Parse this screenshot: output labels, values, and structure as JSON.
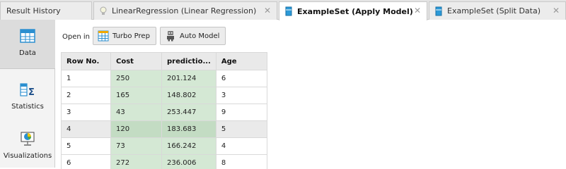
{
  "tabs": [
    {
      "label": "Result History"
    },
    {
      "label": "LinearRegression (Linear Regression)",
      "close": "✕"
    },
    {
      "label": "ExampleSet (Apply Model)",
      "close": "✕"
    },
    {
      "label": "ExampleSet (Split Data)",
      "close": "✕"
    }
  ],
  "sidebar": {
    "items": [
      {
        "label": "Data",
        "icon": "table-icon"
      },
      {
        "label": "Statistics",
        "icon": "statistics-icon"
      },
      {
        "label": "Visualizations",
        "icon": "chart-icon"
      }
    ]
  },
  "toolbar": {
    "open_in_label": "Open in",
    "turbo_prep_label": "Turbo Prep",
    "auto_model_label": "Auto Model"
  },
  "table": {
    "headers": [
      "Row No.",
      "Cost",
      "predictio...",
      "Age"
    ],
    "rows": [
      [
        "1",
        "250",
        "201.124",
        "6"
      ],
      [
        "2",
        "165",
        "148.802",
        "3"
      ],
      [
        "3",
        "43",
        "253.447",
        "9"
      ],
      [
        "4",
        "120",
        "183.683",
        "5"
      ],
      [
        "5",
        "73",
        "166.242",
        "4"
      ],
      [
        "6",
        "272",
        "236.006",
        "8"
      ]
    ]
  },
  "colors": {
    "prediction_highlight": "#d4e8d4",
    "accent_blue": "#1f8fd6"
  }
}
